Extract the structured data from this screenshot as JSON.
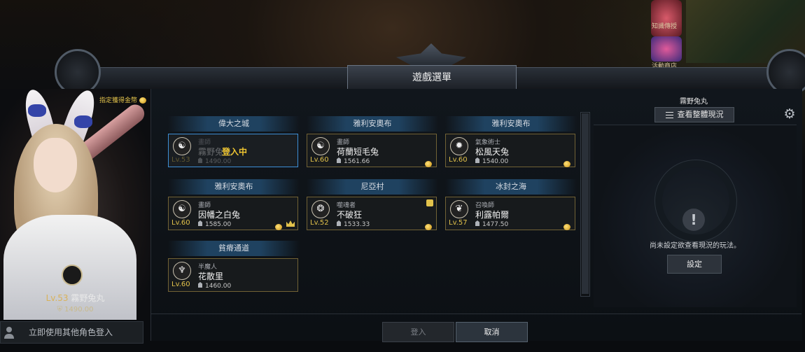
{
  "window": {
    "title": "遊戲選單"
  },
  "hud": {
    "items": [
      {
        "label": "知識傳授",
        "icon": "knowledge-icon"
      },
      {
        "label": "活動商店",
        "icon": "event-shop-icon"
      }
    ]
  },
  "selected_character": {
    "gold_label": "指定獲得金幣",
    "level_prefix": "Lv.53",
    "name": "霧野兔丸",
    "power": "1490.00"
  },
  "other_login_label": "立即使用其他角色登入",
  "servers": [
    {
      "name": "偉大之城",
      "slot": {
        "class": "畫師",
        "name": "霧野兔丸",
        "level": "Lv.53",
        "power": "1490.00",
        "status": "登入中",
        "emblem": "artist-emblem-icon",
        "active": true
      }
    },
    {
      "name": "雅利安奧布",
      "slot": {
        "class": "畫師",
        "name": "荷蘭短毛兔",
        "level": "Lv.60",
        "power": "1561.66",
        "emblem": "artist-emblem-icon"
      }
    },
    {
      "name": "雅利安奧布",
      "slot": {
        "class": "氣象術士",
        "name": "松風天兔",
        "level": "Lv.60",
        "power": "1540.00",
        "emblem": "aeromancer-emblem-icon"
      }
    },
    {
      "name": "雅利安奧布",
      "slot": {
        "class": "畫師",
        "name": "因幡之白兔",
        "level": "Lv.60",
        "power": "1585.00",
        "emblem": "artist-emblem-icon",
        "crown": true
      }
    },
    {
      "name": "尼亞村",
      "slot": {
        "class": "噬魂者",
        "name": "不破狂",
        "level": "Lv.52",
        "power": "1533.33",
        "emblem": "souleater-emblem-icon",
        "gift": true
      }
    },
    {
      "name": "冰封之海",
      "slot": {
        "class": "召喚師",
        "name": "利露帕爾",
        "level": "Lv.57",
        "power": "1477.50",
        "emblem": "summoner-emblem-icon"
      }
    },
    {
      "name": "貧瘠通道",
      "slot": {
        "class": "半魔人",
        "name": "花散里",
        "level": "Lv.60",
        "power": "1460.00",
        "emblem": "demonic-emblem-icon"
      }
    }
  ],
  "right_panel": {
    "character_name": "霧野兔丸",
    "overview_button": "查看整體現況",
    "message": "尚未設定欲查看現況的玩法。",
    "setup_button": "設定"
  },
  "footer": {
    "login_button": "登入",
    "cancel_button": "取消"
  },
  "colors": {
    "accent_gold": "#e2c24b",
    "active_border": "#3d8fd6",
    "slot_border": "#716235"
  }
}
